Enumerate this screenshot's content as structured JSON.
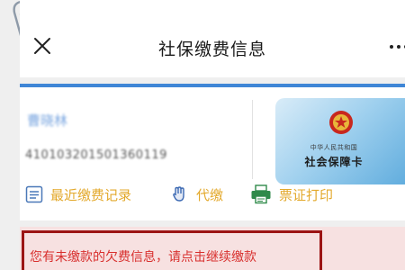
{
  "header": {
    "title": "社保缴费信息",
    "close_icon": "close-icon",
    "more_icon": "more-icon"
  },
  "profile": {
    "name": "曹晓林",
    "id_number": "410103201501360119"
  },
  "social_card": {
    "country_text": "中华人民共和国",
    "card_name": "社会保障卡"
  },
  "actions": [
    {
      "label": "最近缴费记录",
      "icon": "list-icon"
    },
    {
      "label": "代缴",
      "icon": "hand-icon"
    },
    {
      "label": "票证打印",
      "icon": "printer-icon"
    }
  ],
  "alert": {
    "message": "您有未缴款的欠费信息，请点击继续缴款"
  },
  "colors": {
    "accent": "#3f86d6",
    "action_text": "#e3a92c",
    "alert_text": "#d8302e",
    "alert_border": "#9c1414"
  }
}
